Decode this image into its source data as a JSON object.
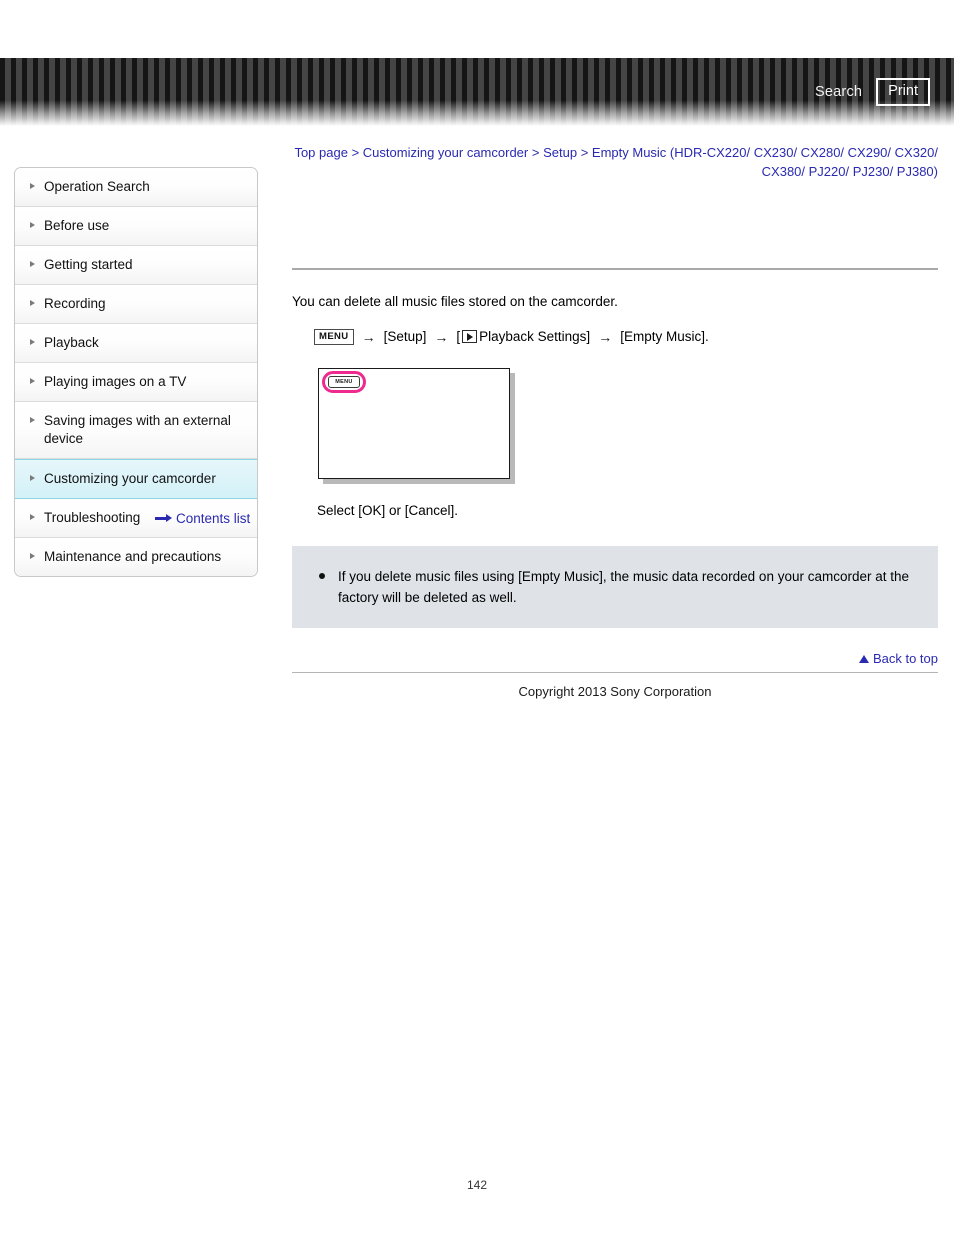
{
  "header": {
    "search_label": "Search",
    "print_label": "Print",
    "search_icon": "search-icon",
    "print_icon": "printer-icon"
  },
  "breadcrumb": {
    "items": [
      {
        "label": "Top page"
      },
      {
        "label": "Customizing your camcorder"
      },
      {
        "label": "Setup"
      },
      {
        "label": "Empty Music (HDR-CX220/ CX230/ CX280/ CX290/ CX320/ CX380/ PJ220/ PJ230/ PJ380)"
      }
    ],
    "separator": ">"
  },
  "sidebar": {
    "items": [
      {
        "label": "Operation Search",
        "active": false
      },
      {
        "label": "Before use",
        "active": false
      },
      {
        "label": "Getting started",
        "active": false
      },
      {
        "label": "Recording",
        "active": false
      },
      {
        "label": "Playback",
        "active": false
      },
      {
        "label": "Playing images on a TV",
        "active": false
      },
      {
        "label": "Saving images with an external device",
        "active": false
      },
      {
        "label": "Customizing your camcorder",
        "active": true
      },
      {
        "label": "Troubleshooting",
        "active": false
      },
      {
        "label": "Maintenance and precautions",
        "active": false
      }
    ],
    "contents_link": "Contents list",
    "contents_icon": "right-arrow-icon"
  },
  "main": {
    "intro": "You can delete all music files stored on the camcorder.",
    "path": {
      "menu_chip": "MENU",
      "arrow": "→",
      "step1": "[Setup]",
      "step2_prefix": "[",
      "step2_label": "Playback Settings]",
      "step2_icon": "play-icon",
      "step3": "[Empty Music]."
    },
    "figure": {
      "menu_button_label": "MENU",
      "highlight_color": "#ef2a8e",
      "alt": "Camcorder screen showing the MENU button highlighted"
    },
    "caption": "Select [OK] or [Cancel].",
    "note": "If you delete music files using [Empty Music], the music data recorded on your camcorder at the factory will be deleted as well.",
    "note_bg_color": "#dfe3e8"
  },
  "footer": {
    "back_to_top": "Back to top",
    "back_to_top_icon": "up-triangle-icon",
    "copyright": "Copyright 2013 Sony Corporation"
  },
  "page": {
    "number": "142"
  }
}
